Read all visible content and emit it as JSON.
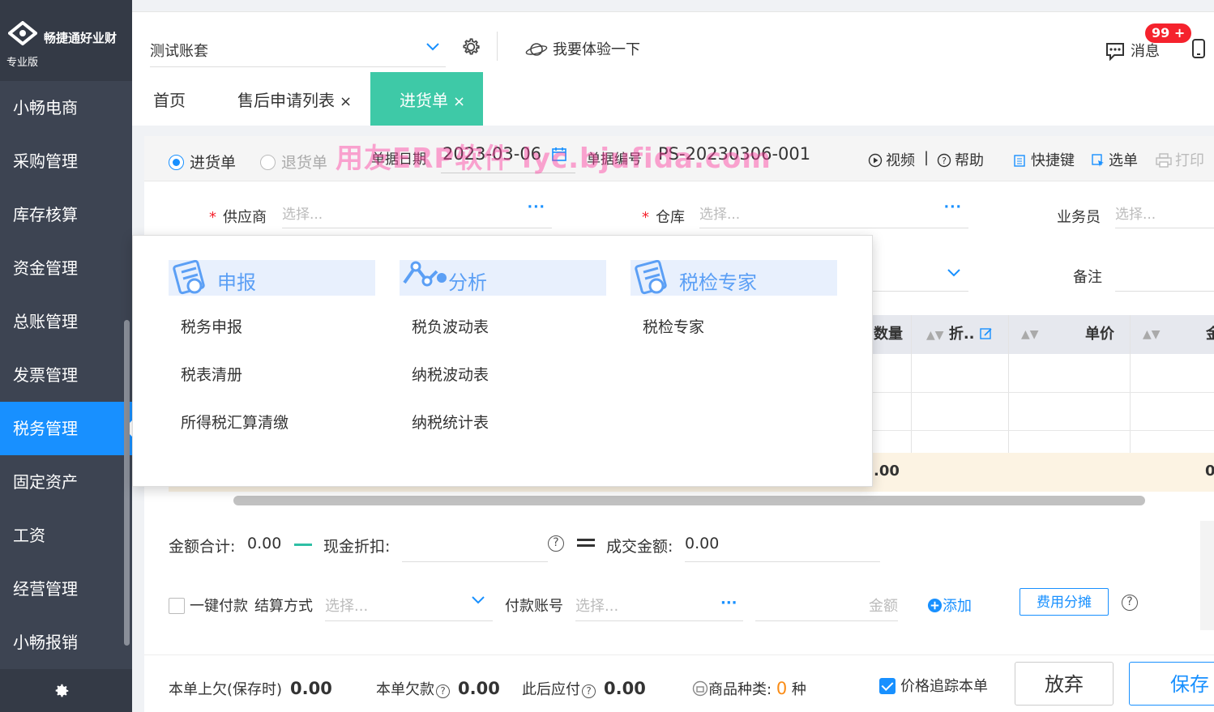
{
  "sidebar": {
    "brand": "畅捷通好业财",
    "edition": "专业版",
    "items": [
      {
        "label": "小畅电商"
      },
      {
        "label": "采购管理"
      },
      {
        "label": "库存核算"
      },
      {
        "label": "资金管理"
      },
      {
        "label": "总账管理"
      },
      {
        "label": "发票管理"
      },
      {
        "label": "税务管理",
        "active": true
      },
      {
        "label": "固定资产"
      },
      {
        "label": "工资"
      },
      {
        "label": "经营管理"
      },
      {
        "label": "小畅报销"
      }
    ]
  },
  "topbar": {
    "account": "测试账套",
    "try_label": "我要体验一下",
    "msg_label": "消息",
    "msg_badge": "99 +"
  },
  "tabs": [
    {
      "label": "首页"
    },
    {
      "label": "售后申请列表",
      "close": "×"
    },
    {
      "label": "进货单",
      "close": "×",
      "active": true
    }
  ],
  "doc": {
    "radio_purchase": "进货单",
    "radio_return": "退货单",
    "date_label": "单据日期",
    "date_value": "2023-03-06",
    "no_label": "单据编号",
    "no_value": "PS-20230306-001",
    "video": "视频",
    "help": "帮助",
    "shortcut": "快捷键",
    "select_doc": "选单",
    "print": "打印",
    "watermark": "用友ERP软件  lyc.bjufida.com",
    "supplier_label": "供应商",
    "supplier_placeholder": "选择...",
    "warehouse_label": "仓库",
    "warehouse_placeholder": "选择...",
    "salesman_label": "业务员",
    "salesman_placeholder": "选择...",
    "remark_label": "备注",
    "more": "···"
  },
  "table": {
    "headers": {
      "qty": "数量",
      "discount": "折..",
      "price": "单价",
      "amount": "金"
    },
    "sum_qty": ".00",
    "sum_amount": "0"
  },
  "summary": {
    "total_label": "金额合计:",
    "total_value": "0.00",
    "cash_discount_label": "现金折扣:",
    "deal_label": "成交金额:",
    "deal_value": "0.00"
  },
  "payment": {
    "one_click": "一键付款",
    "method_label": "结算方式",
    "method_placeholder": "选择...",
    "account_label": "付款账号",
    "account_placeholder": "选择...",
    "amount_placeholder": "金额",
    "add": "添加",
    "alloc": "费用分摊"
  },
  "footer": {
    "prev_owe_label": "本单上欠(保存时)",
    "prev_owe_value": "0.00",
    "this_owe_label": "本单欠款",
    "this_owe_value": "0.00",
    "after_pay_label": "此后应付",
    "after_pay_value": "0.00",
    "kinds_label": "商品种类:",
    "kinds_value": "0",
    "kinds_unit": "种",
    "track_label": "价格追踪本单",
    "abandon": "放弃",
    "save": "保存"
  },
  "popup": {
    "columns": [
      {
        "title": "申报",
        "icon": "doc-stamp-icon",
        "items": [
          "税务申报",
          "税表清册",
          "所得税汇算清缴"
        ]
      },
      {
        "title": "分析",
        "icon": "analysis-chart-icon",
        "items": [
          "税负波动表",
          "纳税波动表",
          "纳税统计表"
        ]
      },
      {
        "title": "税检专家",
        "icon": "tax-check-icon",
        "items": [
          "税检专家"
        ]
      }
    ]
  },
  "colors": {
    "sidebar_bg": "#3d4452",
    "active_blue": "#1890ff",
    "tab_active": "#3ec9a7",
    "popup_head": "#e8f0fd"
  }
}
